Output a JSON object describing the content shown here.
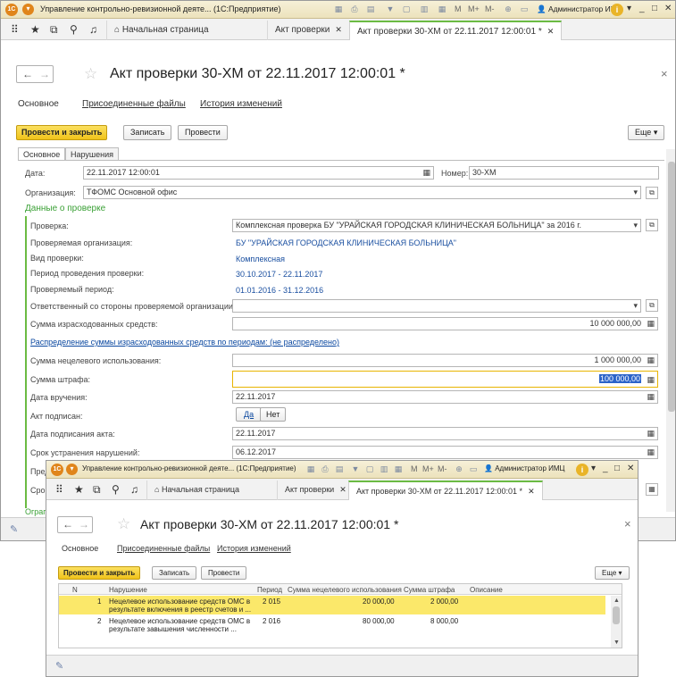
{
  "window": {
    "app_title": "Управление контрольно-ревизионной деяте... (1С:Предприятие)",
    "mem_buttons": [
      "M",
      "M+",
      "M-"
    ],
    "user": "Администратор ИМЦ",
    "controls": [
      "_",
      "□",
      "✕"
    ]
  },
  "nav": {
    "home_tab": "Начальная страница",
    "tabs": [
      {
        "label": "Акт проверки",
        "active": false
      },
      {
        "label": "Акт проверки 30-ХМ от 22.11.2017 12:00:01 *",
        "active": true
      }
    ]
  },
  "doc": {
    "title": "Акт проверки 30-ХМ от 22.11.2017 12:00:01 *",
    "sections": [
      "Основное",
      "Присоединенные файлы",
      "История изменений"
    ],
    "toolbar": {
      "post_close": "Провести и закрыть",
      "write": "Записать",
      "post": "Провести",
      "more": "Еще ▾"
    },
    "subtabs": [
      "Основное",
      "Нарушения"
    ]
  },
  "form": {
    "date_label": "Дата:",
    "date_value": "22.11.2017 12:00:01",
    "number_label": "Номер:",
    "number_value": "30-ХМ",
    "org_label": "Организация:",
    "org_value": "ТФОМС Основной офис",
    "section_title": "Данные о проверке",
    "rows": [
      {
        "label": "Проверка:",
        "value": "Комплексная проверка БУ \"УРАЙСКАЯ ГОРОДСКАЯ КЛИНИЧЕСКАЯ БОЛЬНИЦА\" за 2016 г."
      },
      {
        "label": "Проверяемая организация:",
        "value": "БУ \"УРАЙСКАЯ ГОРОДСКАЯ КЛИНИЧЕСКАЯ БОЛЬНИЦА\""
      },
      {
        "label": "Вид проверки:",
        "value": "Комплексная"
      },
      {
        "label": "Период проведения проверки:",
        "value": "30.10.2017 - 22.11.2017"
      },
      {
        "label": "Проверяемый период:",
        "value": "01.01.2016 - 31.12.2016"
      },
      {
        "label": "Ответственный со стороны проверяемой организации:",
        "value": ""
      },
      {
        "label": "Сумма израсходованных средств:",
        "value": "10 000 000,00"
      }
    ],
    "distribution_link": "Распределение суммы израсходованных средств по периодам: (не распределено)",
    "misuse_label": "Сумма нецелевого использования:",
    "misuse_value": "1 000 000,00",
    "fine_label": "Сумма штрафа:",
    "fine_value": "100 000,00",
    "handover_label": "Дата вручения:",
    "handover_value": "22.11.2017",
    "signed_label": "Акт подписан:",
    "signed_yes": "Да",
    "signed_no": "Нет",
    "sign_date_label": "Дата подписания акта:",
    "sign_date_value": "22.11.2017",
    "deadline_label": "Срок устранения нарушений:",
    "deadline_value": "06.12.2017",
    "cut_label_1": "Пред",
    "cut_label_2": "Срок",
    "cut_label_3": "Ограг"
  },
  "violations": {
    "headers": [
      "N",
      "Нарушение",
      "Период",
      "Сумма нецелевого использования",
      "Сумма штрафа",
      "Описание"
    ],
    "rows": [
      {
        "n": "1",
        "line1": "Нецелевое использование средств ОМС в",
        "line2": "результате включения в реестр счетов и ...",
        "period": "2 015",
        "misuse": "20 000,00",
        "fine": "2 000,00",
        "selected": true
      },
      {
        "n": "2",
        "line1": "Нецелевое использование средств ОМС в",
        "line2": "результате завышения численности ...",
        "period": "2 016",
        "misuse": "80 000,00",
        "fine": "8 000,00",
        "selected": false
      }
    ]
  },
  "colors": {
    "accent_green": "#6bbb43",
    "button_yellow": "#f0c31a",
    "link_blue": "#0b48a0",
    "row_highlight": "#fbe86a"
  }
}
